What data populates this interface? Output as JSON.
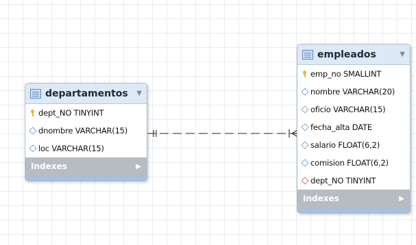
{
  "tables": {
    "departamentos": {
      "title": "departamentos",
      "columns": [
        {
          "text": "dept_NO TINYINT",
          "kind": "key"
        },
        {
          "text": "dnombre VARCHAR(15)",
          "kind": "attr"
        },
        {
          "text": "loc VARCHAR(15)",
          "kind": "attr"
        }
      ],
      "indexes_label": "Indexes"
    },
    "empleados": {
      "title": "empleados",
      "columns": [
        {
          "text": "emp_no SMALLINT",
          "kind": "key"
        },
        {
          "text": "nombre VARCHAR(20)",
          "kind": "attr"
        },
        {
          "text": "oficio VARCHAR(15)",
          "kind": "attr"
        },
        {
          "text": "fecha_alta DATE",
          "kind": "attr"
        },
        {
          "text": "salario FLOAT(6,2)",
          "kind": "attr"
        },
        {
          "text": "comision FLOAT(6,2)",
          "kind": "attr"
        },
        {
          "text": "dept_NO TINYINT",
          "kind": "fk"
        }
      ],
      "indexes_label": "Indexes"
    }
  },
  "relationship": {
    "from": "departamentos",
    "to": "empleados",
    "from_cardinality": "one-and-only-one",
    "to_cardinality": "zero-or-many",
    "style": "dashed"
  },
  "colors": {
    "header": "#dde9f4",
    "border": "#a9bccd",
    "indexes_bar": "#b7bcc3",
    "footer": "#a8c0d8",
    "key_icon": "#e4b93a",
    "attr_icon": "#7fa9cf",
    "fk_icon": "#d8747c",
    "connector": "#555555"
  }
}
